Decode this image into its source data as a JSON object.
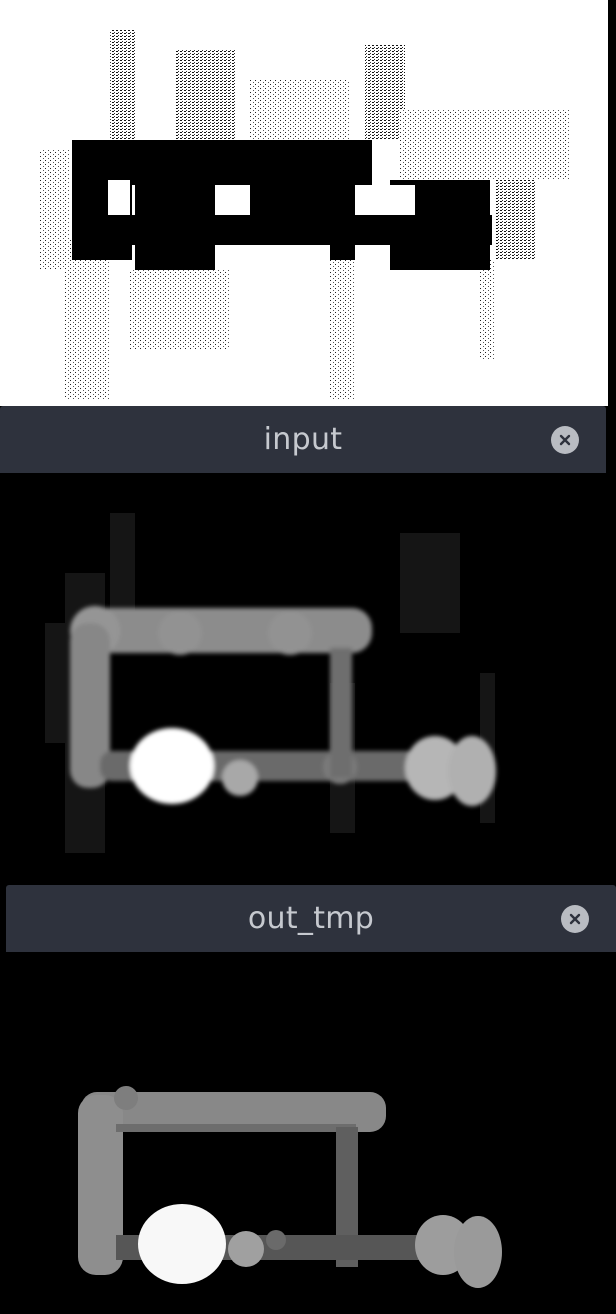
{
  "windows": [
    {
      "title": "input",
      "close_icon": "close-circle-icon"
    },
    {
      "title": "out_tmp",
      "close_icon": "close-circle-icon"
    }
  ],
  "colors": {
    "titlebar": "#2e323d",
    "title_text": "#c6c9cf",
    "close_button": "#b9bcc2",
    "canvas_background": "#000000",
    "map_background": "#ffffff"
  }
}
